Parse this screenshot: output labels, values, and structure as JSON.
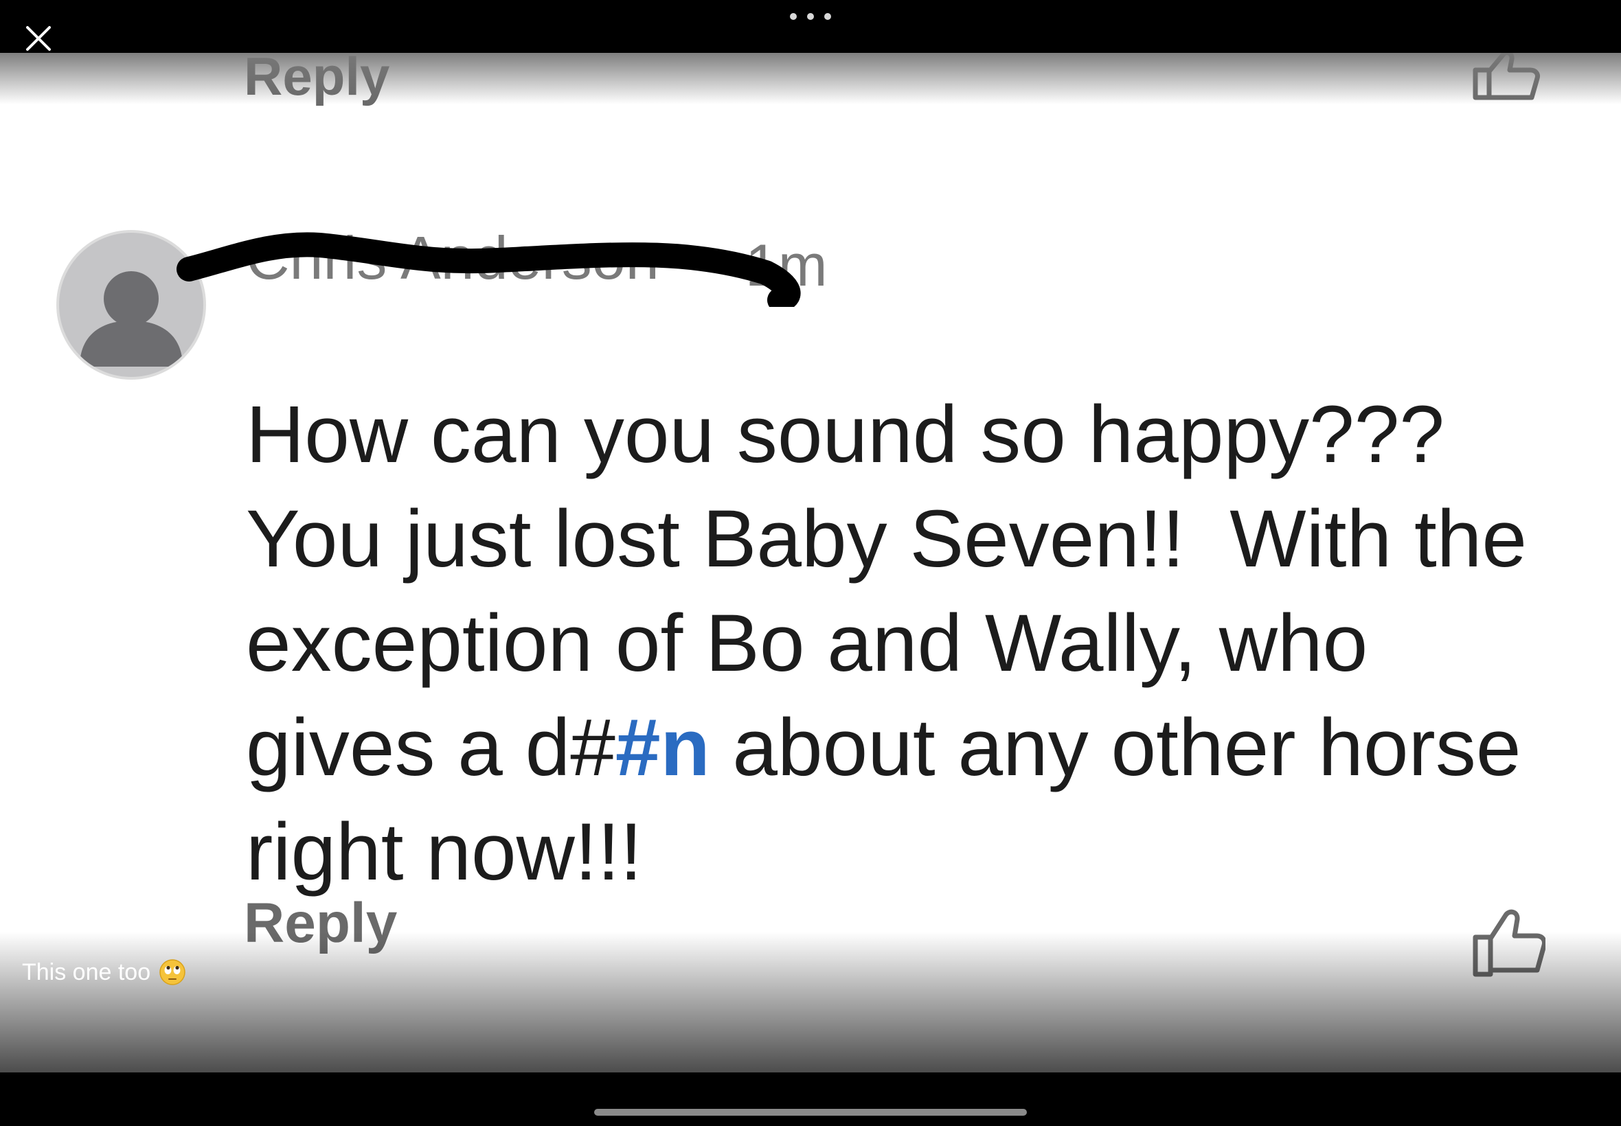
{
  "viewer": {
    "close_icon": "close-icon",
    "more_icon": "more-dots-icon"
  },
  "post": {
    "previous_reply_label": "Reply",
    "author_name": "Chris Anderson",
    "time": "1m",
    "comment_lines": [
      "How can you sound so happy???",
      "You just lost Baby Seven!!  With the",
      "exception of Bo and Wally, who",
      "gives a d#",
      "#n",
      " about any other horse",
      "right now!!!"
    ],
    "reply_label": "Reply",
    "like_icon": "thumbs-up-icon",
    "hashtag_color": "#2a6bc1"
  },
  "caption": {
    "text": "This one too",
    "emoji_icon": "eye-roll-emoji"
  }
}
